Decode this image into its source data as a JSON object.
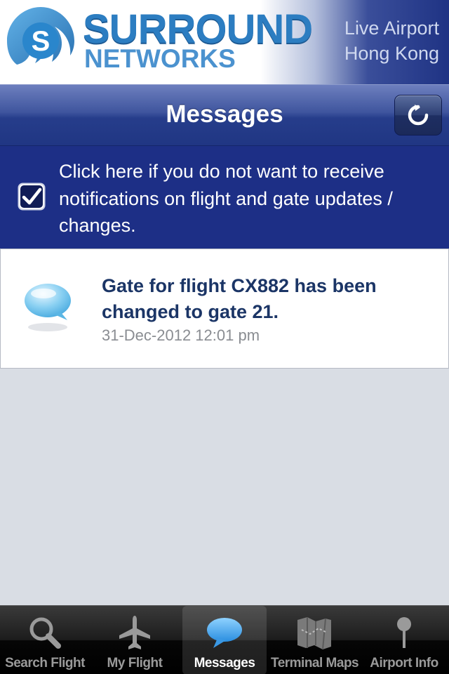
{
  "header": {
    "brand_line1": "SURROUND",
    "brand_line2": "NETWORKS",
    "tagline_line1": "Live Airport",
    "tagline_line2": "Hong Kong",
    "logo_icon": "surround-swirl-logo"
  },
  "titlebar": {
    "title": "Messages",
    "refresh_icon": "refresh-icon"
  },
  "optout": {
    "checked": true,
    "text": "Click here if you do not want to receive notifications on flight and gate updates / changes."
  },
  "messages": [
    {
      "icon": "speech-bubble-icon",
      "text": "Gate for flight CX882 has been changed to gate 21.",
      "timestamp": "31-Dec-2012 12:01 pm"
    }
  ],
  "tabs": [
    {
      "label": "Search Flight",
      "icon": "search-icon",
      "active": false
    },
    {
      "label": "My Flight",
      "icon": "airplane-icon",
      "active": false
    },
    {
      "label": "Messages",
      "icon": "speech-bubble-icon",
      "active": true
    },
    {
      "label": "Terminal Maps",
      "icon": "map-icon",
      "active": false
    },
    {
      "label": "Airport Info",
      "icon": "pin-icon",
      "active": false
    }
  ],
  "colors": {
    "brand_blue": "#2c7dc1",
    "bar_blue": "#1d2f86",
    "message_text": "#1b3566",
    "timestamp_gray": "#8a8d92"
  }
}
